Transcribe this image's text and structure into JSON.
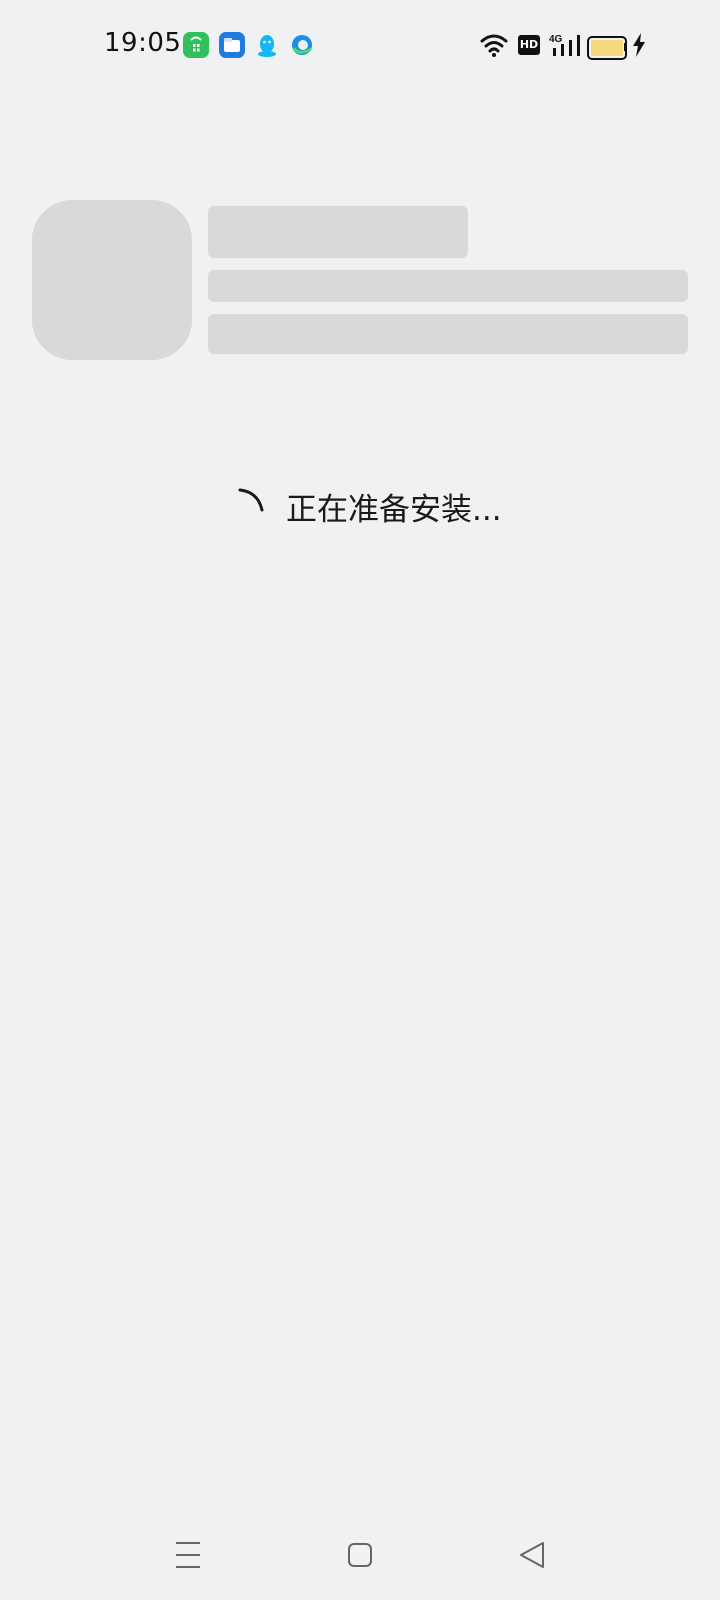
{
  "status_bar": {
    "time": "19:05",
    "notification_icons": [
      "app-market-icon",
      "file-manager-icon",
      "qq-icon",
      "browser-icon"
    ],
    "hd_label": "HD",
    "network_label": "4G",
    "battery_color": "#f6d97c"
  },
  "loading": {
    "text": "正在准备安装..."
  },
  "nav_bar": {
    "buttons": [
      "menu-icon",
      "home-icon",
      "back-icon"
    ]
  },
  "colors": {
    "background": "#eff1f3",
    "skeleton": "#d9d9d9",
    "text": "#1a1a1a"
  }
}
